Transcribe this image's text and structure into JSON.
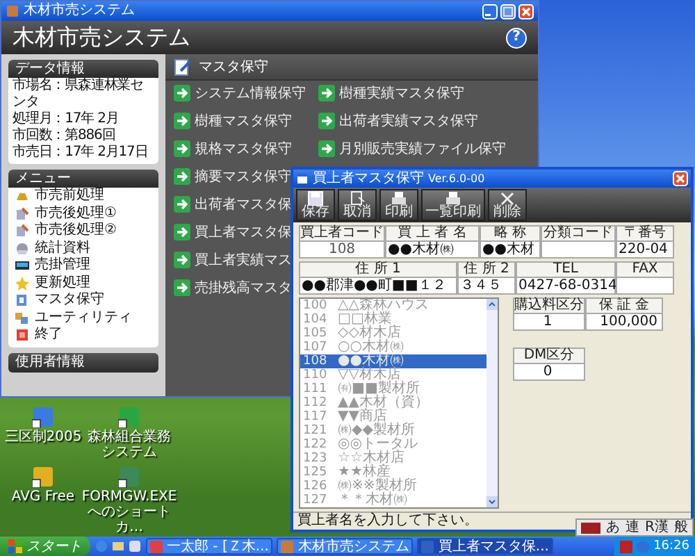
{
  "main_window": {
    "title": "木材市売システム",
    "header": "木材市売システム",
    "help": "?",
    "data_info": {
      "heading": "データ情報",
      "lines": [
        "市場名：県森連林業センタ",
        "処理月：17年 2月",
        "市回数：第886回",
        "市売日：17年 2月17日"
      ]
    },
    "menu": {
      "heading": "メニュー",
      "items": [
        {
          "label": "市売前処理"
        },
        {
          "label": "市売後処理①"
        },
        {
          "label": "市売後処理②"
        },
        {
          "label": "統計資料"
        },
        {
          "label": "売掛管理"
        },
        {
          "label": "更新処理"
        },
        {
          "label": "マスタ保守"
        },
        {
          "label": "ユーティリティ"
        },
        {
          "label": "終了"
        }
      ]
    },
    "user_info": {
      "label": "使用者情報"
    },
    "content": {
      "heading": "マスタ保守",
      "column_1": [
        {
          "label": "システム情報保守"
        },
        {
          "label": "樹種マスタ保守"
        },
        {
          "label": "規格マスタ保守"
        },
        {
          "label": "摘要マスタ保守"
        },
        {
          "label": "出荷者マスタ保"
        },
        {
          "label": "買上者マスタ保"
        },
        {
          "label": "買上者実績マス"
        },
        {
          "label": "売掛残高マスタ"
        }
      ],
      "column_2": [
        {
          "label": "樹種実績マスタ保守"
        },
        {
          "label": "出荷者実績マスタ保守"
        },
        {
          "label": "月別販売実績ファイル保守"
        }
      ]
    }
  },
  "dialog": {
    "title": "買上者マスタ保守",
    "version": "Ver.6.0-00",
    "toolbar": [
      {
        "label": "保存"
      },
      {
        "label": "取消"
      },
      {
        "label": "印刷"
      },
      {
        "label": "一覧印刷"
      },
      {
        "label": "削除"
      }
    ],
    "fields_row_1": [
      {
        "label": "買上者コード",
        "value": "108"
      },
      {
        "label": "買 上 者 名",
        "value": "●●木材㈱"
      },
      {
        "label": "略 称",
        "value": "●●木材"
      },
      {
        "label": "分類コード"
      },
      {
        "label": "〒番号",
        "value": "220-04"
      }
    ],
    "fields_row_2": [
      {
        "label": "住 所 1",
        "value": "●●郡津●●町■■１２"
      },
      {
        "label": "住 所 2",
        "value": "３４５"
      },
      {
        "label": "TEL",
        "value": "0427-68-0314"
      },
      {
        "label": "FAX"
      }
    ],
    "list": [
      {
        "code": "100",
        "name": "△△森林ハウス",
        "selected": false
      },
      {
        "code": "104",
        "name": "□□林業",
        "selected": false
      },
      {
        "code": "105",
        "name": "◇◇材木店",
        "selected": false
      },
      {
        "code": "107",
        "name": "○○木材㈱",
        "selected": false
      },
      {
        "code": "108",
        "name": "●●木材㈱",
        "selected": true
      },
      {
        "code": "110",
        "name": "▽▽材木店",
        "selected": false
      },
      {
        "code": "111",
        "name": "㈲■■製材所",
        "selected": false
      },
      {
        "code": "112",
        "name": "▲▲木材（資）",
        "selected": false
      },
      {
        "code": "117",
        "name": "▼▼商店",
        "selected": false
      },
      {
        "code": "121",
        "name": "㈱◆◆製材所",
        "selected": false
      },
      {
        "code": "122",
        "name": "◎◎トータル",
        "selected": false
      },
      {
        "code": "123",
        "name": "☆☆木材店",
        "selected": false
      },
      {
        "code": "125",
        "name": "★★林産",
        "selected": false
      },
      {
        "code": "126",
        "name": "㈱※※製材所",
        "selected": false
      },
      {
        "code": "127",
        "name": "＊＊木材㈱",
        "selected": false
      }
    ],
    "fields_side": [
      {
        "label": "購込料区分",
        "value": "1"
      },
      {
        "label": "保 証 金",
        "value": "100,000"
      },
      {
        "label": "DM区分",
        "value": "0"
      }
    ],
    "status": "買上者名を入力して下さい。"
  },
  "desktop_icons": [
    {
      "label": "三区制2005"
    },
    {
      "label": "森林組合業務システム"
    },
    {
      "label": "AVG Free"
    },
    {
      "label": "FORMGW.EXE へのショートカ…"
    }
  ],
  "language_bar": [
    "あ",
    "連",
    "R漢",
    "般"
  ],
  "taskbar": {
    "start": "スタート",
    "tasks": [
      {
        "label": "一太郎 - [Ｚ木...",
        "selected": false
      },
      {
        "label": "木材市売システム",
        "selected": false
      },
      {
        "label": "買上者マスタ保...",
        "selected": true
      }
    ],
    "clock": "16:26"
  }
}
